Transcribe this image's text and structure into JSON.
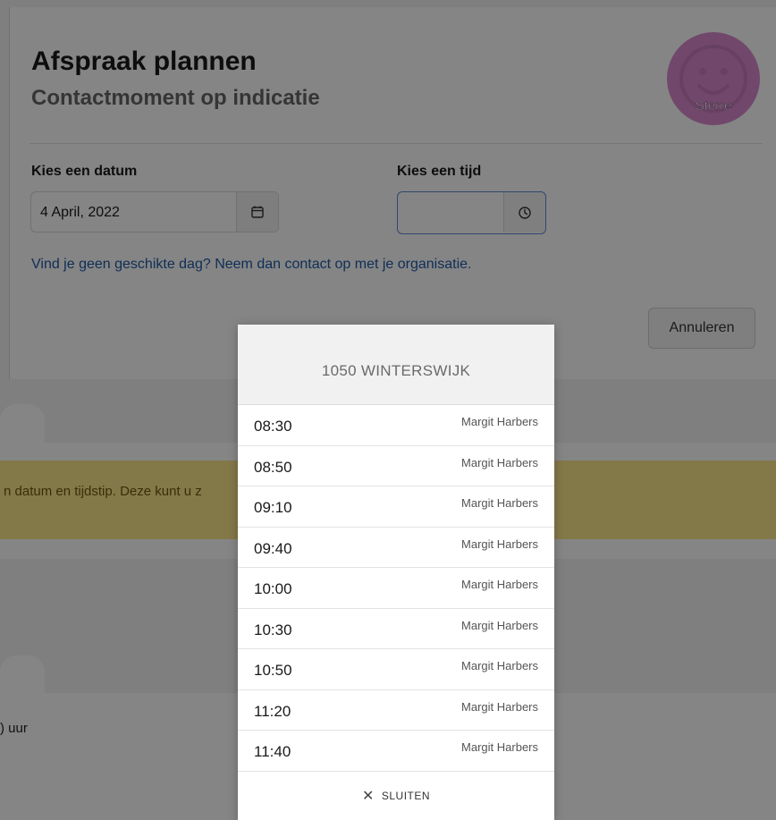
{
  "modal": {
    "title": "Afspraak plannen",
    "subtitle": "Contactmoment op indicatie",
    "avatar_label": "Sterre",
    "date_label": "Kies een datum",
    "date_value": "4 April, 2022",
    "time_label": "Kies een tijd",
    "time_value": "",
    "help_text": "Vind je geen geschikte dag? Neem dan contact op met je organisatie.",
    "cancel_label": "Annuleren"
  },
  "background": {
    "warning_text": "n datum en tijdstip. Deze kunt u z",
    "time_text": ") uur"
  },
  "picker": {
    "location": "1050 WINTERSWIJK",
    "slots": [
      {
        "time": "08:30",
        "person": "Margit Harbers"
      },
      {
        "time": "08:50",
        "person": "Margit Harbers"
      },
      {
        "time": "09:10",
        "person": "Margit Harbers"
      },
      {
        "time": "09:40",
        "person": "Margit Harbers"
      },
      {
        "time": "10:00",
        "person": "Margit Harbers"
      },
      {
        "time": "10:30",
        "person": "Margit Harbers"
      },
      {
        "time": "10:50",
        "person": "Margit Harbers"
      },
      {
        "time": "11:20",
        "person": "Margit Harbers"
      },
      {
        "time": "11:40",
        "person": "Margit Harbers"
      }
    ],
    "close_label": "SLUITEN"
  },
  "colors": {
    "link": "#1f5aa6",
    "avatar": "#d88ad0",
    "warning_bg": "#fbe68a",
    "focus_border": "#5b8bd6"
  },
  "icons": {
    "date_button": "calendar-icon",
    "time_button": "clock-icon",
    "avatar": "smiley-icon",
    "close": "close-icon"
  }
}
